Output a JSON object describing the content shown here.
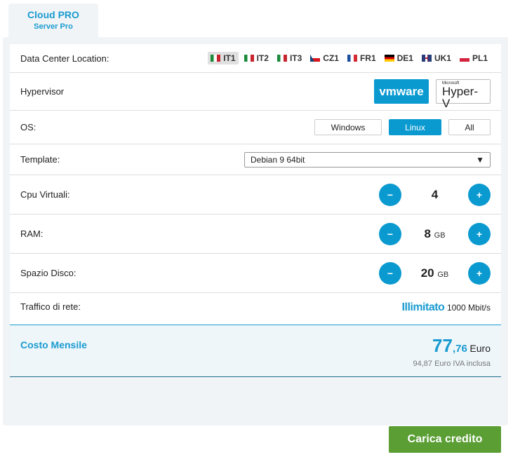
{
  "tab": {
    "title": "Cloud PRO",
    "subtitle": "Server Pro"
  },
  "location": {
    "label": "Data Center Location:",
    "items": [
      {
        "code": "IT1",
        "selected": true,
        "c": [
          "#1a8a3a",
          "#fff",
          "#c8262e"
        ],
        "dir": "v"
      },
      {
        "code": "IT2",
        "selected": false,
        "c": [
          "#1a8a3a",
          "#fff",
          "#c8262e"
        ],
        "dir": "v"
      },
      {
        "code": "IT3",
        "selected": false,
        "c": [
          "#1a8a3a",
          "#fff",
          "#c8262e"
        ],
        "dir": "v"
      },
      {
        "code": "CZ1",
        "selected": false,
        "c": [
          "#fff",
          "#d7141a"
        ],
        "dir": "cz"
      },
      {
        "code": "FR1",
        "selected": false,
        "c": [
          "#1d4fa0",
          "#fff",
          "#d42b35"
        ],
        "dir": "v"
      },
      {
        "code": "DE1",
        "selected": false,
        "c": [
          "#000",
          "#d00",
          "#fc0"
        ],
        "dir": "h"
      },
      {
        "code": "UK1",
        "selected": false,
        "c": [
          "#283d7a",
          "#c8102e",
          "#fff"
        ],
        "dir": "uk"
      },
      {
        "code": "PL1",
        "selected": false,
        "c": [
          "#fff",
          "#d4213d"
        ],
        "dir": "h"
      }
    ]
  },
  "hypervisor": {
    "label": "Hypervisor",
    "vmware": "vmware",
    "hyperv_brand": "Microsoft",
    "hyperv": "Hyper-V"
  },
  "os": {
    "label": "OS:",
    "options": [
      "Windows",
      "Linux",
      "All"
    ],
    "selected": "Linux"
  },
  "template": {
    "label": "Template:",
    "value": "Debian 9 64bit"
  },
  "cpu": {
    "label": "Cpu Virtuali:",
    "value": "4",
    "unit": ""
  },
  "ram": {
    "label": "RAM:",
    "value": "8",
    "unit": "GB"
  },
  "disk": {
    "label": "Spazio Disco:",
    "value": "20",
    "unit": "GB"
  },
  "traffic": {
    "label": "Traffico di rete:",
    "value": "Illimitato",
    "speed": "1000 Mbit/s"
  },
  "cost": {
    "label": "Costo Mensile",
    "int": "77",
    "dec": ",76",
    "currency": "Euro",
    "vat": "94,87 Euro IVA inclusa"
  },
  "cta": "Carica credito",
  "steppers": {
    "minus": "−",
    "plus": "+"
  }
}
